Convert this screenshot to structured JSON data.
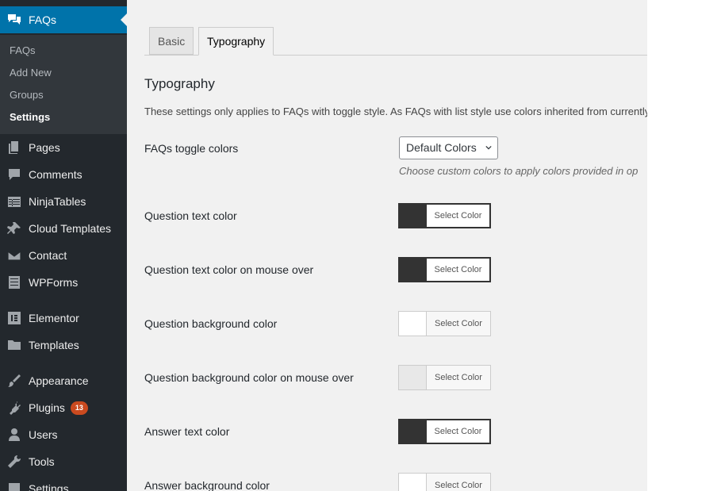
{
  "sidebar": {
    "faqs": {
      "label": "FAQs",
      "icon": "speech-bubbles-icon"
    },
    "submenu": [
      "FAQs",
      "Add New",
      "Groups",
      "Settings"
    ],
    "active_sub": "Settings",
    "items": [
      {
        "label": "Pages",
        "icon": "pages-icon"
      },
      {
        "label": "Comments",
        "icon": "comment-icon"
      },
      {
        "label": "NinjaTables",
        "icon": "table-icon"
      },
      {
        "label": "Cloud Templates",
        "icon": "pin-icon"
      },
      {
        "label": "Contact",
        "icon": "mail-icon"
      },
      {
        "label": "WPForms",
        "icon": "form-icon"
      },
      {
        "label": "Elementor",
        "icon": "elementor-icon"
      },
      {
        "label": "Templates",
        "icon": "folder-icon"
      },
      {
        "label": "Appearance",
        "icon": "brush-icon"
      },
      {
        "label": "Plugins",
        "icon": "plugin-icon",
        "badge": "13"
      },
      {
        "label": "Users",
        "icon": "user-icon"
      },
      {
        "label": "Tools",
        "icon": "wrench-icon"
      },
      {
        "label": "Settings",
        "icon": "settings-icon"
      }
    ]
  },
  "tabs": [
    "Basic",
    "Typography"
  ],
  "active_tab": "Typography",
  "main": {
    "heading": "Typography",
    "description": "These settings only applies to FAQs with toggle style. As FAQs with list style use colors inherited from currently",
    "toggle_colors": {
      "label": "FAQs toggle colors",
      "selected": "Default Colors",
      "note": "Choose custom colors to apply colors provided in op"
    },
    "color_rows": [
      {
        "label": "Question text color",
        "button": "Select Color",
        "swatch": "#333333"
      },
      {
        "label": "Question text color on mouse over",
        "button": "Select Color",
        "swatch": "#333333"
      },
      {
        "label": "Question background color",
        "button": "Select Color",
        "swatch": "#ffffff"
      },
      {
        "label": "Question background color on mouse over",
        "button": "Select Color",
        "swatch": "#e8e8e8"
      },
      {
        "label": "Answer text color",
        "button": "Select Color",
        "swatch": "#333333"
      },
      {
        "label": "Answer background color",
        "button": "Select Color",
        "swatch": "#ffffff"
      }
    ]
  },
  "colors": {
    "accent": "#0073aa",
    "sidebar_bg": "#23282d",
    "badge": "#ca4a1f"
  }
}
